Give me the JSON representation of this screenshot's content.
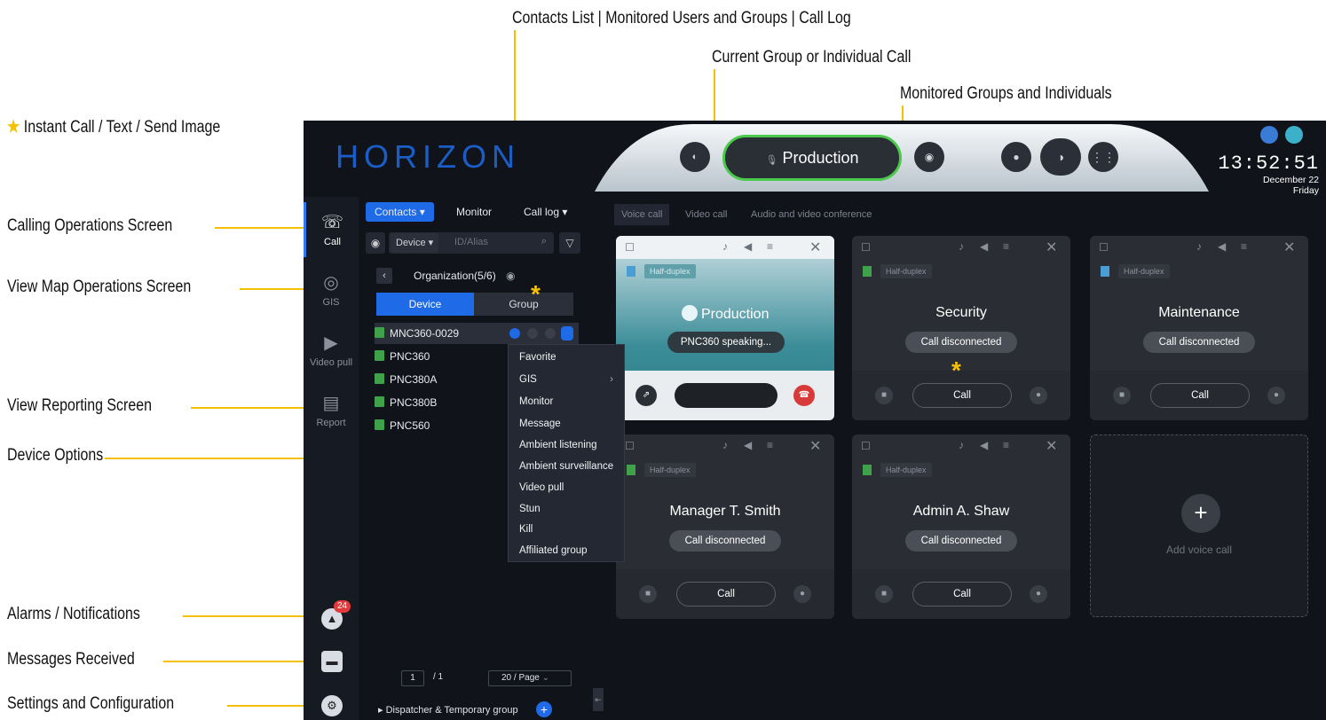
{
  "annotations": {
    "top_contacts": "Contacts List | Monitored Users and Groups | Call Log",
    "top_current": "Current Group or Individual Call",
    "top_monitored": "Monitored Groups and Individuals",
    "instant_call": "Instant Call / Text / Send Image",
    "calling_ops": "Calling Operations Screen",
    "map_ops": "View Map Operations Screen",
    "reporting": "View Reporting Screen",
    "device_options": "Device Options",
    "alarms": "Alarms / Notifications",
    "messages": "Messages Received",
    "settings": "Settings and Configuration",
    "accent_color": "#f5c000"
  },
  "app": {
    "brand": "HORIZON",
    "time": "13:52:51",
    "date": "December 22",
    "weekday": "Friday",
    "current_call": "Production"
  },
  "rail": {
    "call": "Call",
    "gis": "GIS",
    "video_pull": "Video pull",
    "report": "Report",
    "alarm_count": "24"
  },
  "contacts": {
    "tab_contacts": "Contacts ▾",
    "tab_monitor": "Monitor",
    "tab_call_log": "Call log ▾",
    "search_type": "Device ▾",
    "search_placeholder": "ID/Alias",
    "org": "Organization(5/6)",
    "seg_device": "Device",
    "seg_group": "Group",
    "devices": [
      "MNC360-0029",
      "PNC360",
      "PNC380A",
      "PNC380B",
      "PNC560"
    ],
    "page_current": "1",
    "page_total": "/ 1",
    "page_size": "20 / Page",
    "dispatcher": "Dispatcher & Temporary group"
  },
  "device_menu": [
    "Favorite",
    "GIS",
    "Monitor",
    "Message",
    "Ambient listening",
    "Ambient surveillance",
    "Video pull",
    "Stun",
    "Kill",
    "Affiliated group"
  ],
  "call_tabs": [
    "Voice call",
    "Video call",
    "Audio and video conference"
  ],
  "cards": [
    {
      "title": "Production",
      "status": "PNC360 speaking...",
      "mode": "Half-duplex"
    },
    {
      "title": "Security",
      "status": "Call disconnected",
      "mode": "Half-duplex",
      "button": "Call"
    },
    {
      "title": "Maintenance",
      "status": "Call disconnected",
      "mode": "Half-duplex",
      "button": "Call"
    },
    {
      "title": "Manager T. Smith",
      "status": "Call disconnected",
      "mode": "Half-duplex",
      "button": "Call"
    },
    {
      "title": "Admin A. Shaw",
      "status": "Call disconnected",
      "mode": "Half-duplex",
      "button": "Call"
    }
  ],
  "add_voice_call": "Add voice call"
}
